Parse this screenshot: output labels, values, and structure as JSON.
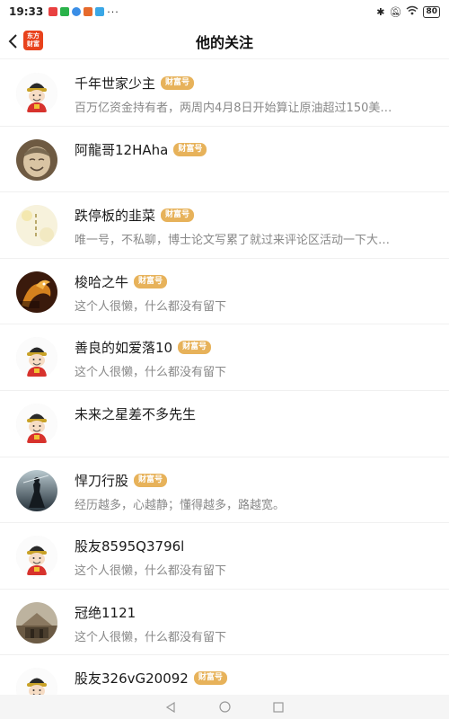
{
  "status_bar": {
    "time": "19:33",
    "dots": "···",
    "battery": "80"
  },
  "header": {
    "title": "他的关注",
    "logo_line1": "东方",
    "logo_line2": "财富"
  },
  "badge_label": "财富号",
  "follows": [
    {
      "name": "千年世家少主",
      "badge": true,
      "desc": "百万亿资金持有者，两周内4月8日开始算让原油超过150美…",
      "avatar": "fortune-god"
    },
    {
      "name": "阿龍哥12HAha",
      "badge": true,
      "desc": "",
      "avatar": "buddha-statue"
    },
    {
      "name": "跌停板的韭菜",
      "badge": true,
      "desc": "唯一号，不私聊，博士论文写累了就过来评论区活动一下大…",
      "avatar": "calligraphy"
    },
    {
      "name": "梭哈之牛",
      "badge": true,
      "desc": "这个人很懒，什么都没有留下",
      "avatar": "dragon"
    },
    {
      "name": "善良的如爱落10",
      "badge": true,
      "desc": "这个人很懒，什么都没有留下",
      "avatar": "fortune-god"
    },
    {
      "name": "未来之星差不多先生",
      "badge": false,
      "desc": "",
      "avatar": "fortune-god"
    },
    {
      "name": "悍刀行股",
      "badge": true,
      "desc": "经历越多，心越静；懂得越多，路越宽。",
      "avatar": "swordsman"
    },
    {
      "name": "股友8595Q3796l",
      "badge": false,
      "desc": "这个人很懒，什么都没有留下",
      "avatar": "fortune-god"
    },
    {
      "name": "冠绝1121",
      "badge": false,
      "desc": "这个人很懒，什么都没有留下",
      "avatar": "building"
    },
    {
      "name": "股友326vG20092",
      "badge": true,
      "desc": "",
      "avatar": "fortune-god"
    }
  ]
}
